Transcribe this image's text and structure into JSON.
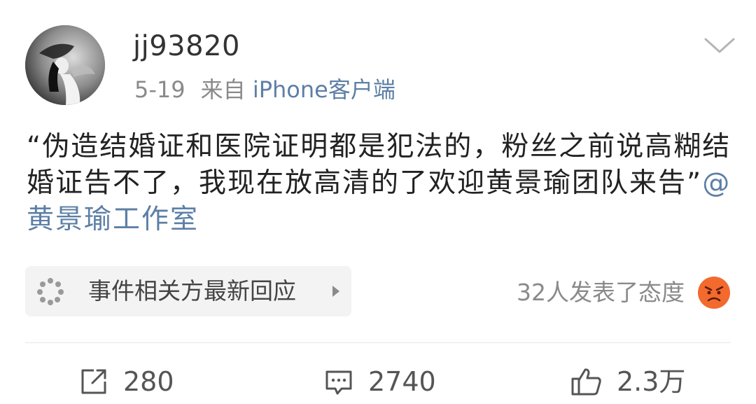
{
  "post": {
    "author": "jj93820",
    "date": "5-19",
    "source_prefix": "来自",
    "source": "iPhone客户端",
    "content_text": "“伪造结婚证和医院证明都是犯法的，粉丝之前说高糊结婚证告不了，我现在放高清的了欢迎黄景瑜团队来告”",
    "mention": "@黄景瑜工作室"
  },
  "event": {
    "label": "事件相关方最新回应",
    "icon": "burst-icon",
    "arrow_icon": "triangle-right-icon"
  },
  "attitude": {
    "text": "32人发表了态度",
    "emoji": "angry-face-icon"
  },
  "actions": {
    "repost_count": "280",
    "comment_count": "2740",
    "like_count": "2.3万"
  },
  "colors": {
    "link": "#5d7fa6",
    "text": "#222222",
    "muted": "#8a8a8a",
    "card_bg": "#f3f3f3",
    "emoji": "#f26a2e"
  }
}
